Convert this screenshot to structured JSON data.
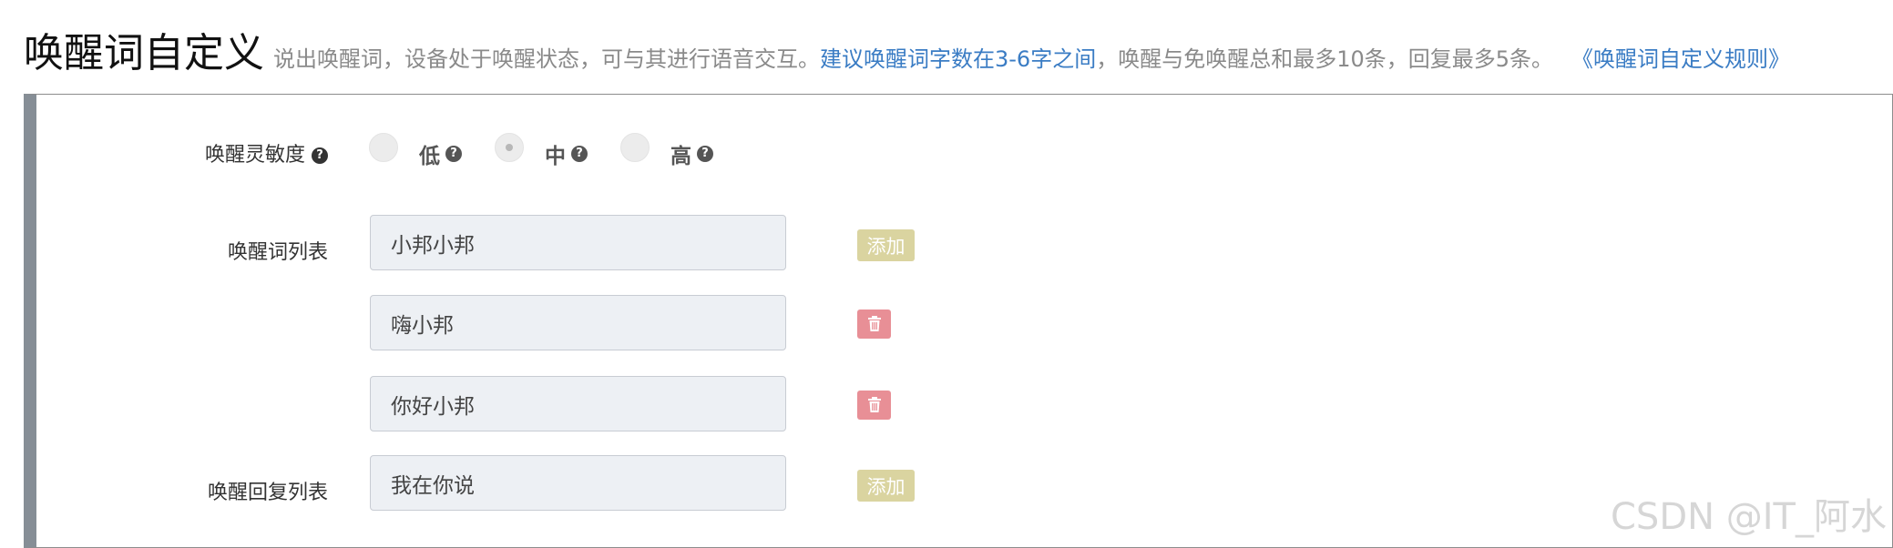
{
  "header": {
    "title": "唤醒词自定义",
    "desc_part1": "说出唤醒词，设备处于唤醒状态，可与其进行语音交互。",
    "desc_highlight": "建议唤醒词字数在3-6字之间",
    "desc_part2": "，唤醒与免唤醒总和最多10条，回复最多5条。",
    "rules_link": "《唤醒词自定义规则》"
  },
  "sensitivity": {
    "label": "唤醒灵敏度",
    "options": [
      {
        "label": "低",
        "checked": false
      },
      {
        "label": "中",
        "checked": true
      },
      {
        "label": "高",
        "checked": false
      }
    ]
  },
  "wake_words": {
    "label": "唤醒词列表",
    "items": [
      "小邦小邦",
      "嗨小邦",
      "你好小邦"
    ],
    "add_label": "添加"
  },
  "replies": {
    "label": "唤醒回复列表",
    "items": [
      "我在你说"
    ],
    "add_label": "添加"
  },
  "icons": {
    "help": "question-circle-icon",
    "delete": "trash-icon"
  },
  "colors": {
    "link": "#3a7cc4",
    "add_button": "#dad4a0",
    "delete_button": "#e88f96",
    "input_bg": "#edf0f4"
  },
  "watermark": "CSDN @IT_阿水"
}
